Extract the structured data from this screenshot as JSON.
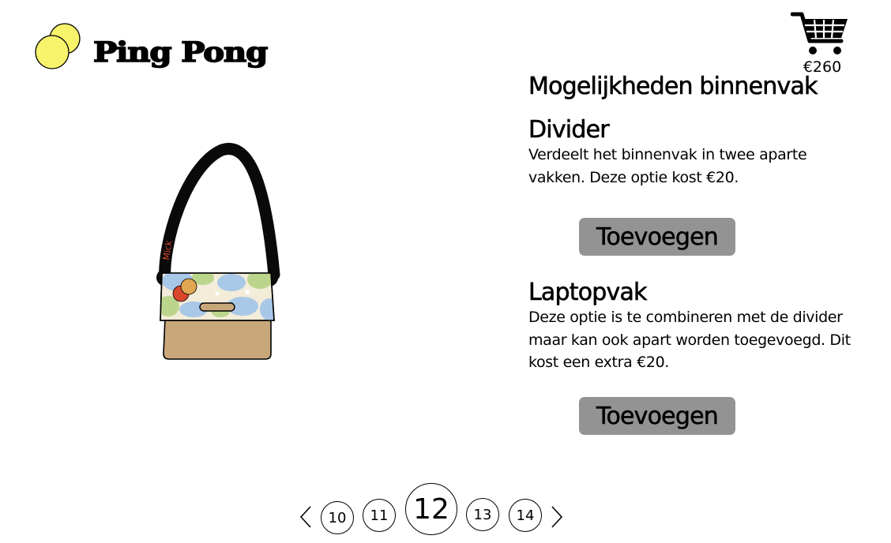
{
  "brand": {
    "name": "Ping Pong",
    "logo_icon": "two-yellow-circles",
    "logo_color": "#f7f36b"
  },
  "cart": {
    "icon": "shopping-cart-icon",
    "total": "€260"
  },
  "product": {
    "image": "crossbody-bag-preview",
    "strap_text": "Mick"
  },
  "options_panel": {
    "title": "Mogelijkheden binnenvak",
    "options": [
      {
        "title": "Divider",
        "description": "Verdeelt het binnenvak in twee aparte vakken. Deze optie kost €20.",
        "button_label": "Toevoegen"
      },
      {
        "title": "Laptopvak",
        "description": "Deze optie is te combineren met de divider maar kan ook apart worden toegevoegd. Dit kost een extra €20.",
        "button_label": "Toevoegen"
      }
    ]
  },
  "pagination": {
    "prev_icon": "chevron-left-icon",
    "next_icon": "chevron-right-icon",
    "pages": [
      "10",
      "11",
      "12",
      "13",
      "14"
    ],
    "current": "12"
  },
  "colors": {
    "button": "#939393",
    "bag_body": "#c8a77b",
    "strap": "#0a0a0a",
    "strap_text": "#d9472b"
  }
}
